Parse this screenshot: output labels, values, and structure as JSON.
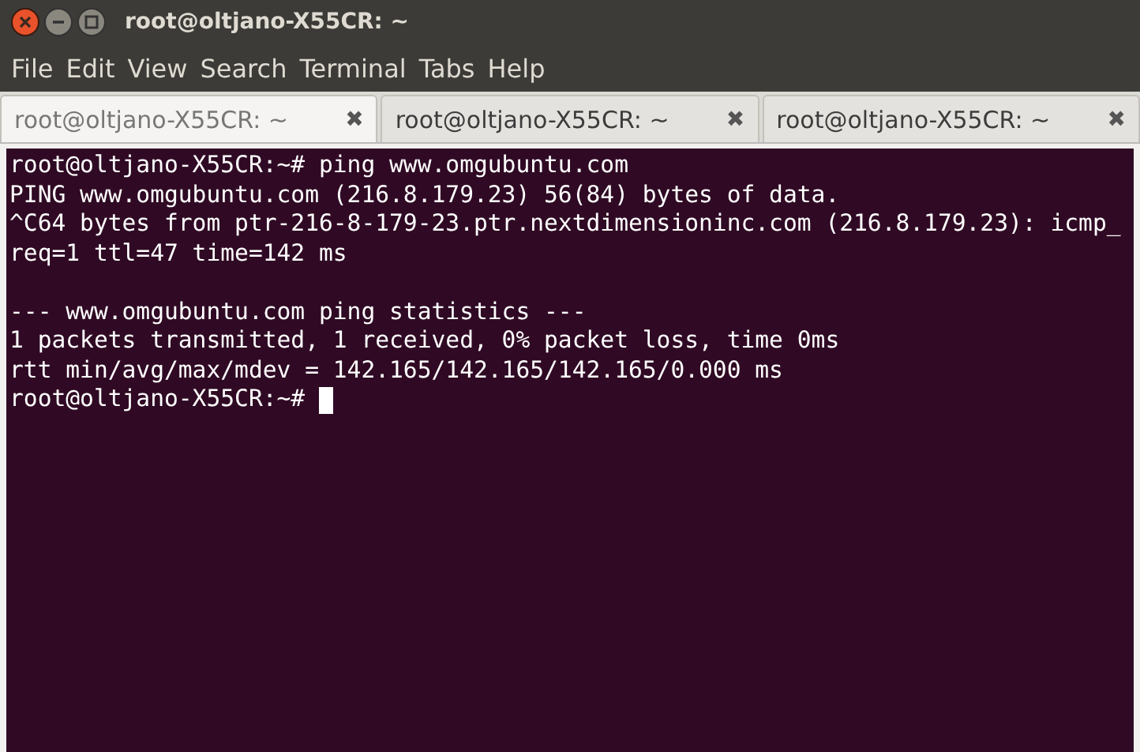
{
  "window": {
    "title": "root@oltjano-X55CR: ~"
  },
  "menu": [
    "File",
    "Edit",
    "View",
    "Search",
    "Terminal",
    "Tabs",
    "Help"
  ],
  "tabs": [
    {
      "label": "root@oltjano-X55CR: ~",
      "selected": true,
      "close": "✖"
    },
    {
      "label": "root@oltjano-X55CR: ~",
      "selected": false,
      "close": "✖"
    },
    {
      "label": "root@oltjano-X55CR: ~",
      "selected": false,
      "close": "✖"
    }
  ],
  "terminal": {
    "lines": [
      "root@oltjano-X55CR:~# ping www.omgubuntu.com",
      "PING www.omgubuntu.com (216.8.179.23) 56(84) bytes of data.",
      "^C64 bytes from ptr-216-8-179-23.ptr.nextdimensioninc.com (216.8.179.23): icmp_",
      "req=1 ttl=47 time=142 ms"
    ],
    "statistics": [
      "--- www.omgubuntu.com ping statistics ---",
      "1 packets transmitted, 1 received, 0% packet loss, time 0ms",
      "rtt min/avg/max/mdev = 142.165/142.165/142.165/0.000 ms"
    ],
    "prompt": "root@oltjano-X55CR:~#"
  }
}
